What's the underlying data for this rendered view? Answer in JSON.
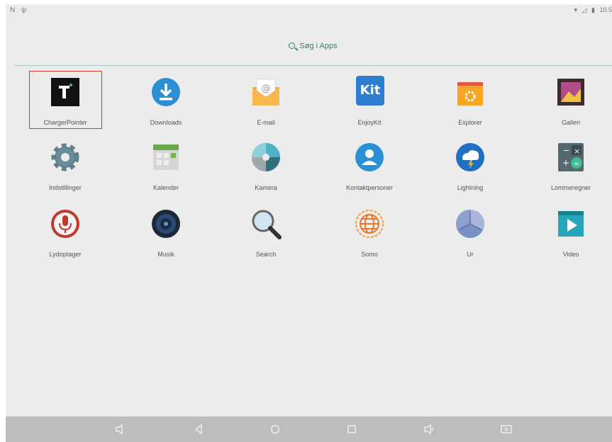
{
  "status_bar": {
    "left_icons": [
      "N",
      "ψ"
    ],
    "time": "10.5"
  },
  "search": {
    "label": "Søg i Apps"
  },
  "apps": [
    {
      "label": "ChargerPointer",
      "icon": "chargerpointer-icon",
      "selected": true
    },
    {
      "label": "Downloads",
      "icon": "download-icon"
    },
    {
      "label": "E-mail",
      "icon": "email-icon"
    },
    {
      "label": "EnjoyKit",
      "icon": "kit-icon",
      "icon_text": "Kit"
    },
    {
      "label": "Explorer",
      "icon": "folder-icon"
    },
    {
      "label": "Galleri",
      "icon": "gallery-icon"
    },
    {
      "label": "Indstillinger",
      "icon": "gear-icon"
    },
    {
      "label": "Kalender",
      "icon": "calendar-icon"
    },
    {
      "label": "Kamera",
      "icon": "camera-icon"
    },
    {
      "label": "Kontaktpersoner",
      "icon": "contacts-icon"
    },
    {
      "label": "Lightning",
      "icon": "lightning-icon"
    },
    {
      "label": "Lommeregner",
      "icon": "calculator-icon"
    },
    {
      "label": "Lydoptager",
      "icon": "microphone-icon"
    },
    {
      "label": "Musik",
      "icon": "speaker-icon"
    },
    {
      "label": "Search",
      "icon": "magnifier-icon"
    },
    {
      "label": "Somo",
      "icon": "globe-icon"
    },
    {
      "label": "Ur",
      "icon": "clock-icon"
    },
    {
      "label": "Video",
      "icon": "video-icon"
    }
  ],
  "colors": {
    "background": "#ececec",
    "accent": "#2f7f7a",
    "selection": "#d63a34",
    "nav_bar": "#bdbdbd"
  }
}
